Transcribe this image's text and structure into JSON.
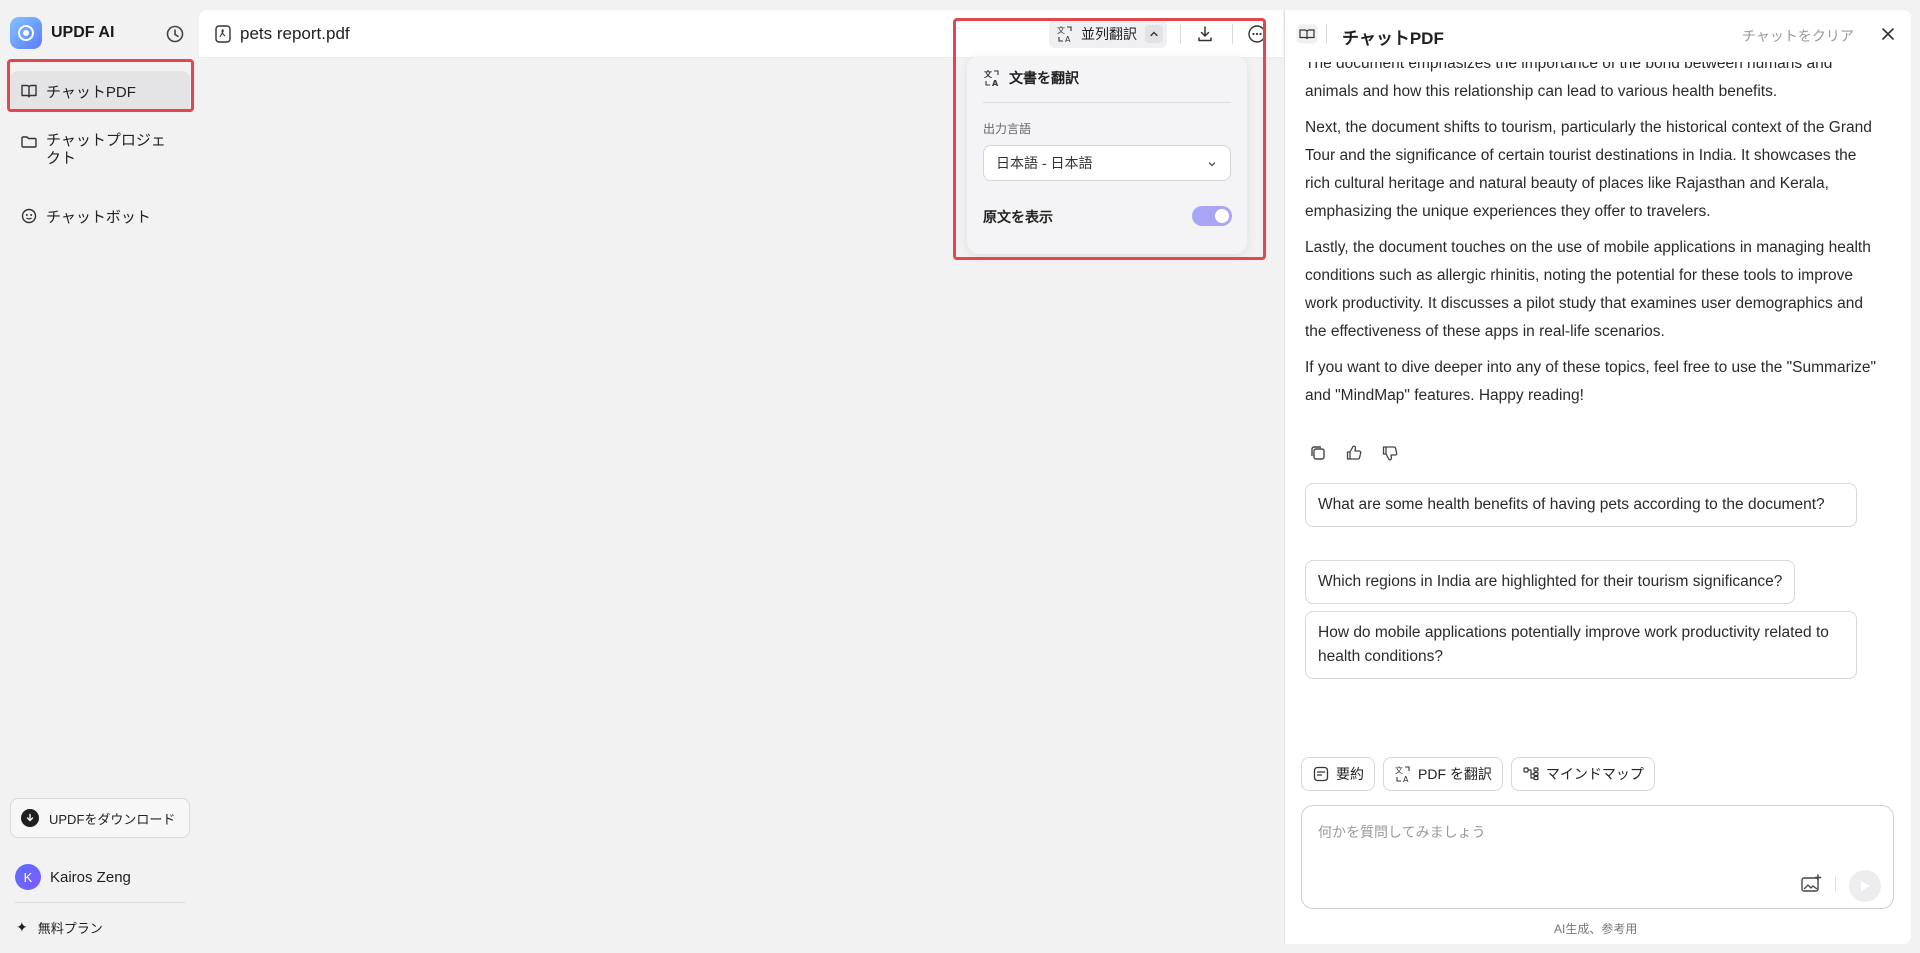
{
  "app": {
    "name": "UPDF AI"
  },
  "sidebar": {
    "items": [
      {
        "label": "チャットPDF",
        "active": true
      },
      {
        "label": "チャットプロジェクト"
      },
      {
        "label": "チャットボット"
      }
    ],
    "download_label": "UPDFをダウンロード",
    "user_initial": "K",
    "user_name": "Kairos Zeng",
    "plan_label": "無料プラン"
  },
  "document": {
    "file_name": "pets report.pdf",
    "translate_button_label": "並列翻訳"
  },
  "translate_panel": {
    "title": "文書を翻訳",
    "output_language_label": "出力言語",
    "selected_language": "日本語 - 日本語",
    "show_original_label": "原文を表示",
    "show_original_on": true
  },
  "chat": {
    "title": "チャットPDF",
    "clear_label": "チャットをクリア",
    "messages": [
      "The document emphasizes the importance of the bond between humans and animals and how this relationship can lead to various health benefits.",
      "Next, the document shifts to tourism, particularly the historical context of the Grand Tour and the significance of certain tourist destinations in India. It showcases the rich cultural heritage and natural beauty of places like Rajasthan and Kerala, emphasizing the unique experiences they offer to travelers.",
      "Lastly, the document touches on the use of mobile applications in managing health conditions such as allergic rhinitis, noting the potential for these tools to improve work productivity. It discusses a pilot study that examines user demographics and the effectiveness of these apps in real-life scenarios.",
      "If you want to dive deeper into any of these topics, feel free to use the \"Summarize\" and \"MindMap\" features. Happy reading!"
    ],
    "suggestions": [
      "What are some health benefits of having pets according to the document?",
      "Which regions in India are highlighted for their tourism significance?",
      "How do mobile applications potentially improve work productivity related to health conditions?"
    ],
    "tools": [
      {
        "label": "要約"
      },
      {
        "label": "PDF を翻訳"
      },
      {
        "label": "マインドマップ"
      }
    ],
    "input_placeholder": "何かを質問してみましょう",
    "footer_note": "AI生成、参考用"
  },
  "colors": {
    "highlight": "#e0484b",
    "toggle_on": "#a8a6f4",
    "brand_gradient_start": "#7fc4ff",
    "brand_gradient_end": "#5b7cff"
  }
}
